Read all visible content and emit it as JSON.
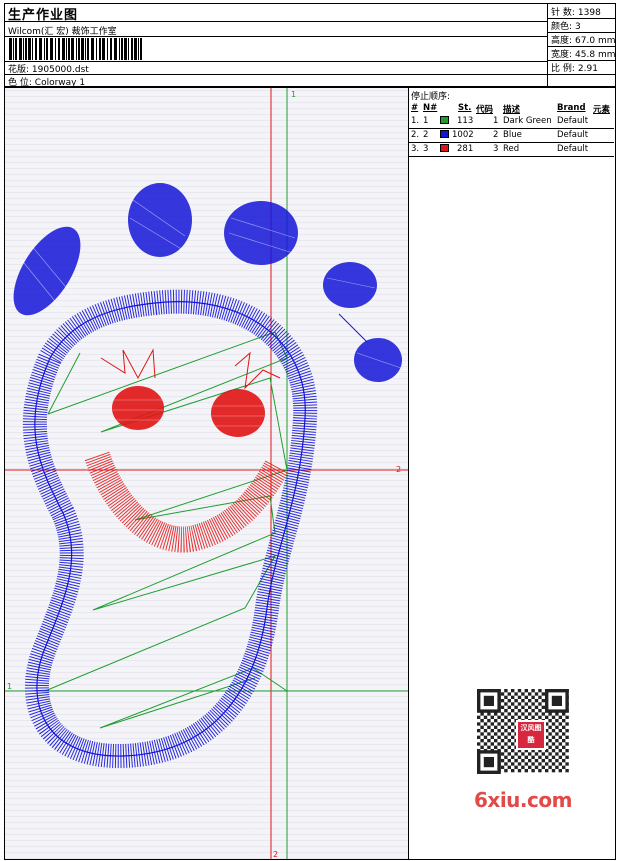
{
  "header": {
    "title": "生产作业图",
    "company": "Wilcom(汇 宏) 裁饰工作室",
    "design_label": "花版:",
    "design_value": "1905000.dst",
    "colorway_label": "色 位:",
    "colorway_value": "Colorway 1"
  },
  "stats": [
    {
      "label": "针 数:",
      "value": "1398"
    },
    {
      "label": "颜色:",
      "value": "3"
    },
    {
      "label": "高度:",
      "value": "67.0 mm"
    },
    {
      "label": "宽度:",
      "value": "45.8 mm"
    },
    {
      "label": "比 例:",
      "value": "2.91"
    }
  ],
  "stop_sequence": {
    "title": "停止顺序:",
    "columns": [
      "#",
      "N#",
      "St.",
      "代码",
      "描述",
      "Brand",
      "元素"
    ],
    "rows": [
      {
        "num": "1.",
        "n": "1",
        "color": "#1f9e2f",
        "stitches": "113",
        "code": "1",
        "desc": "Dark Green",
        "brand": "Default"
      },
      {
        "num": "2.",
        "n": "2",
        "color": "#1414d8",
        "stitches": "1002",
        "code": "2",
        "desc": "Blue",
        "brand": "Default"
      },
      {
        "num": "3.",
        "n": "3",
        "color": "#e01414",
        "stitches": "281",
        "code": "3",
        "desc": "Red",
        "brand": "Default"
      }
    ]
  },
  "guides": {
    "marker_1": "1",
    "marker_2": "2"
  },
  "colors": {
    "blue": "#1414d8",
    "red": "#e01414",
    "green": "#1f9e2f"
  },
  "watermark": "6xiu.com",
  "qr_badge": "汉风图酷"
}
